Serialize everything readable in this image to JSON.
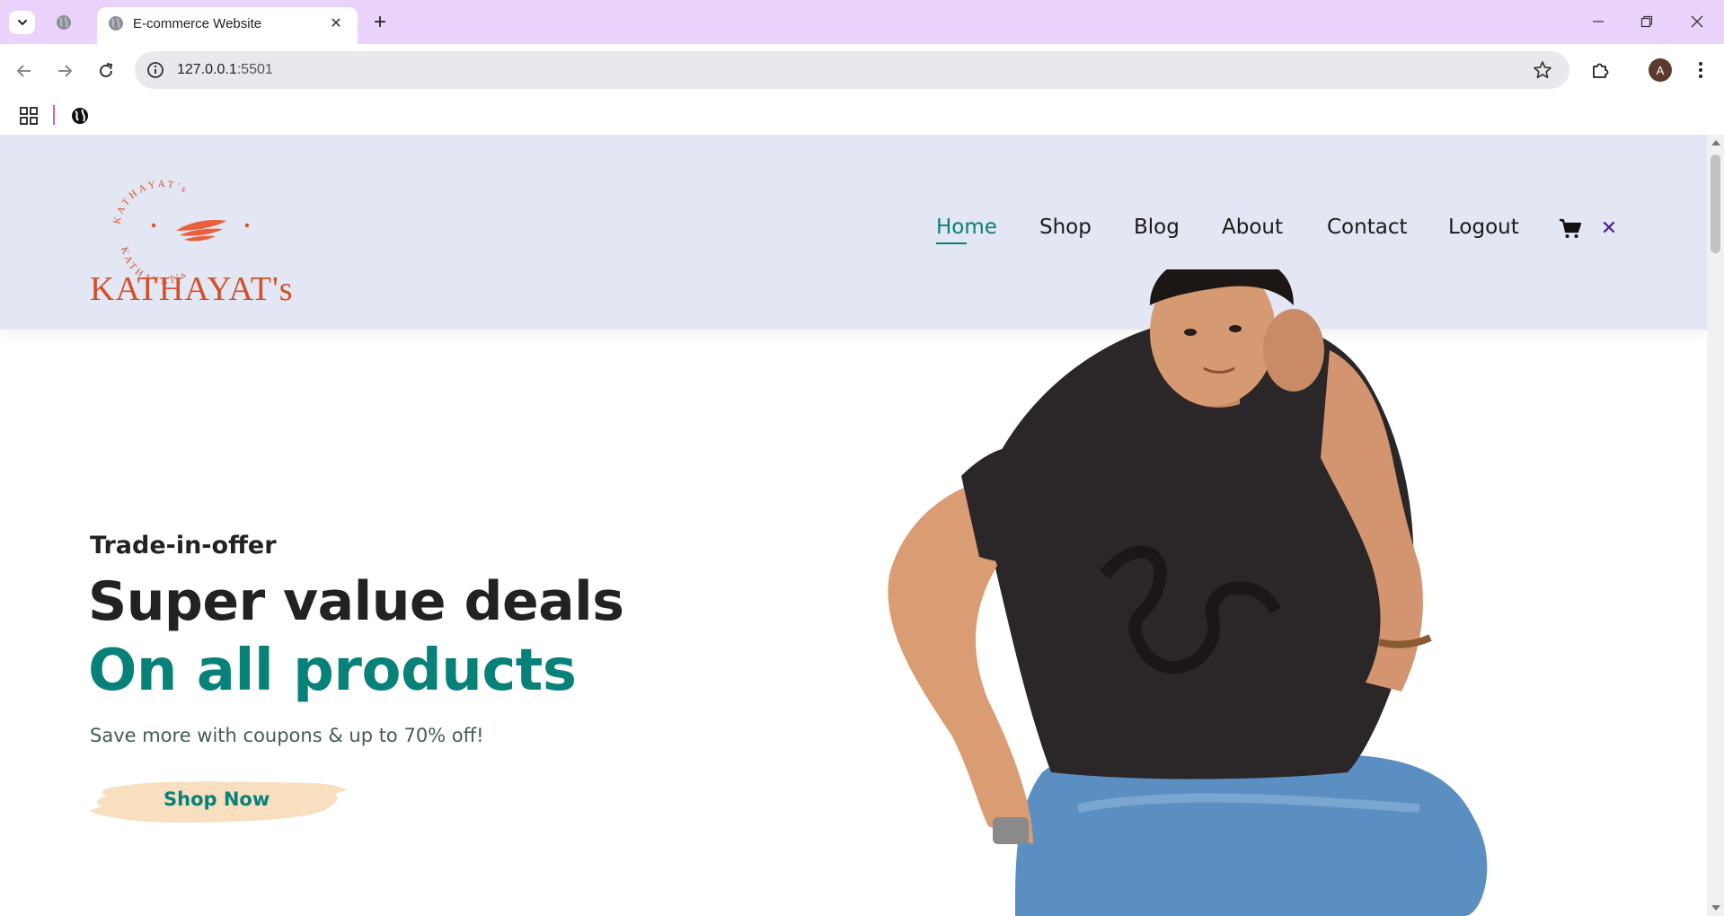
{
  "browser": {
    "tab_title": "E-commerce Website",
    "url_host": "127.0.0.1",
    "url_port": ":5501",
    "profile_initial": "A",
    "accent": "#e9d3fb"
  },
  "header": {
    "logo_ring_text": "KATHAYAT's",
    "logo_wordmark": "KATHAYAT's",
    "brand_color": "#d4502a",
    "background": "#e3e6f3"
  },
  "nav": {
    "items": [
      {
        "label": "Home",
        "active": true
      },
      {
        "label": "Shop",
        "active": false
      },
      {
        "label": "Blog",
        "active": false
      },
      {
        "label": "About",
        "active": false
      },
      {
        "label": "Contact",
        "active": false
      },
      {
        "label": "Logout",
        "active": false
      }
    ],
    "cart_icon": "cart-icon",
    "close_icon": "close-icon",
    "active_color": "#088178"
  },
  "hero": {
    "kicker": "Trade-in-offer",
    "title_line1": "Super value deals",
    "title_line2": "On all products",
    "subtitle": "Save more with coupons & up to 70% off!",
    "cta_label": "Shop Now",
    "title_accent": "#088178"
  }
}
